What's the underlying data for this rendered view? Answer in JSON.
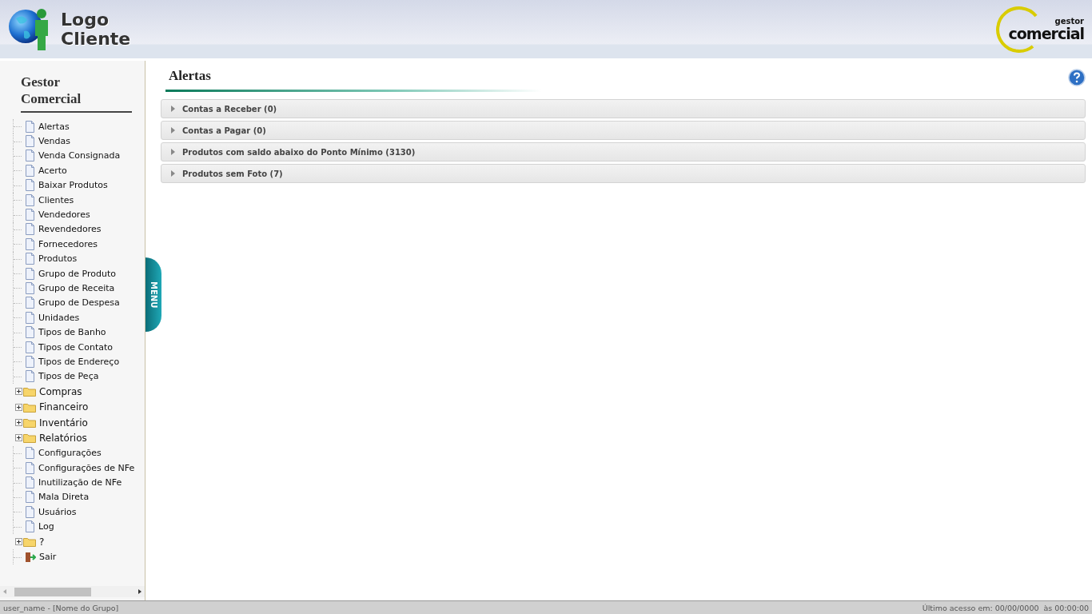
{
  "header": {
    "logo_text": [
      "Logo",
      "Cliente"
    ],
    "brand": {
      "small": "gestor",
      "large": "comercial"
    }
  },
  "sidebar": {
    "title": "Gestor Comercial",
    "menu_tab": "MENU",
    "items": [
      {
        "kind": "page",
        "label": "Alertas"
      },
      {
        "kind": "page",
        "label": "Vendas"
      },
      {
        "kind": "page",
        "label": "Venda Consignada"
      },
      {
        "kind": "page",
        "label": "Acerto"
      },
      {
        "kind": "page",
        "label": "Baixar Produtos"
      },
      {
        "kind": "page",
        "label": "Clientes"
      },
      {
        "kind": "page",
        "label": "Vendedores"
      },
      {
        "kind": "page",
        "label": "Revendedores"
      },
      {
        "kind": "page",
        "label": "Fornecedores"
      },
      {
        "kind": "page",
        "label": "Produtos"
      },
      {
        "kind": "page",
        "label": "Grupo de Produto"
      },
      {
        "kind": "page",
        "label": "Grupo de Receita"
      },
      {
        "kind": "page",
        "label": "Grupo de Despesa"
      },
      {
        "kind": "page",
        "label": "Unidades"
      },
      {
        "kind": "page",
        "label": "Tipos de Banho"
      },
      {
        "kind": "page",
        "label": "Tipos de Contato"
      },
      {
        "kind": "page",
        "label": "Tipos de Endereço"
      },
      {
        "kind": "page",
        "label": "Tipos de Peça"
      },
      {
        "kind": "folder",
        "label": "Compras",
        "expanded": false
      },
      {
        "kind": "folder",
        "label": "Financeiro",
        "expanded": false
      },
      {
        "kind": "folder",
        "label": "Inventário",
        "expanded": false
      },
      {
        "kind": "folder",
        "label": "Relatórios",
        "expanded": false
      },
      {
        "kind": "page",
        "label": "Configurações"
      },
      {
        "kind": "page",
        "label": "Configurações de NFe"
      },
      {
        "kind": "page",
        "label": "Inutilização de NFe"
      },
      {
        "kind": "page",
        "label": "Mala Direta"
      },
      {
        "kind": "page",
        "label": "Usuários"
      },
      {
        "kind": "page",
        "label": "Log"
      },
      {
        "kind": "folder",
        "label": "?",
        "expanded": false
      },
      {
        "kind": "exit",
        "label": "Sair"
      }
    ]
  },
  "main": {
    "title": "Alertas",
    "panels": [
      {
        "label": "Contas a Receber (0)",
        "expanded": false
      },
      {
        "label": "Contas a Pagar (0)",
        "expanded": false
      },
      {
        "label": "Produtos com saldo abaixo do Ponto Mínimo (3130)",
        "expanded": false
      },
      {
        "label": "Produtos sem Foto (7)",
        "expanded": false
      }
    ]
  },
  "status_bar": {
    "user": "user_name - [Nome do Grupo]",
    "last_access": "Último acesso em: 00/00/0000  às 00:00:00"
  }
}
